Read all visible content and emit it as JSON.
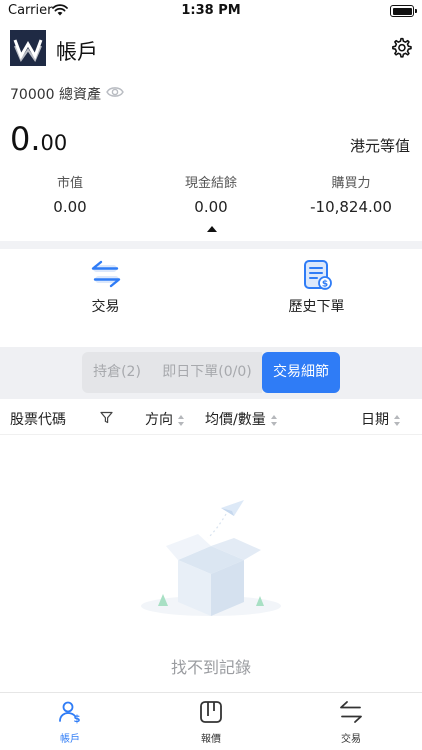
{
  "status_bar": {
    "carrier": "Carrier",
    "time": "1:38 PM"
  },
  "header": {
    "title": "帳戶",
    "settings_icon": "gear-icon",
    "logo_icon": "brand-logo"
  },
  "summary": {
    "total_assets_label": "70000 總資產",
    "amount_int": "0.",
    "amount_dec": "00",
    "currency_label": "港元等值",
    "stats": [
      {
        "label": "市值",
        "value": "0.00"
      },
      {
        "label": "現金結餘",
        "value": "0.00"
      },
      {
        "label": "購買力",
        "value": "-10,824.00"
      }
    ]
  },
  "quick_actions": [
    {
      "label": "交易",
      "icon": "swap-arrows-icon"
    },
    {
      "label": "歷史下單",
      "icon": "order-history-icon"
    }
  ],
  "segments": [
    {
      "label": "持倉(2)",
      "active": false
    },
    {
      "label": "即日下單(0/0)",
      "active": false
    },
    {
      "label": "交易細節",
      "active": true
    }
  ],
  "table": {
    "columns": [
      "股票代碼",
      "方向",
      "均價/數量",
      "日期"
    ]
  },
  "empty_state": {
    "text": "找不到記錄"
  },
  "tabbar": [
    {
      "label": "帳戶",
      "icon": "user-account-icon",
      "active": true
    },
    {
      "label": "報價",
      "icon": "quote-icon",
      "active": false
    },
    {
      "label": "交易",
      "icon": "trade-swap-icon",
      "active": false
    }
  ],
  "colors": {
    "accent": "#2f7cf6",
    "brand": "#1f2a44",
    "muted": "#9a9ca0"
  }
}
